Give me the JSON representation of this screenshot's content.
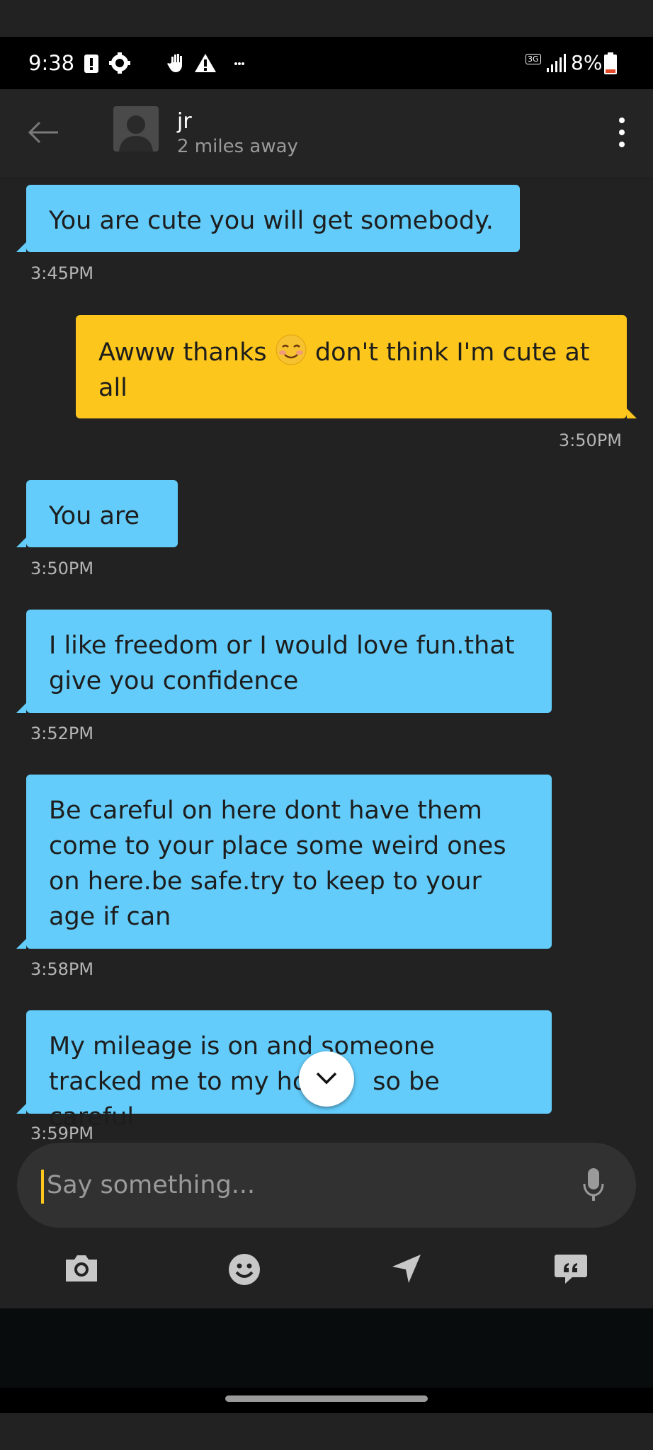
{
  "status_bar": {
    "time": "9:38",
    "network": "3G",
    "battery": "8%"
  },
  "header": {
    "name": "jr",
    "distance": "2 miles away"
  },
  "messages": [
    {
      "direction": "in",
      "text": "You are cute you will get somebody.",
      "time": "3:45PM"
    },
    {
      "direction": "out",
      "text_before_emoji": "Awww thanks",
      "emoji": "smiling-face-icon",
      "text_after_emoji": "don't think I'm cute at all",
      "time": "3:50PM"
    },
    {
      "direction": "in",
      "text": "You are",
      "time": "3:50PM"
    },
    {
      "direction": "in",
      "text": "I like freedom or I would love fun.that give you confidence",
      "time": "3:52PM"
    },
    {
      "direction": "in",
      "text": "Be careful on here dont have them come to your place some weird ones on here.be safe.try to keep to your age if can",
      "time": "3:58PM"
    },
    {
      "direction": "in",
      "text_part1": "My mileage is on and someone",
      "text_part2": "tracked me to my ho",
      "text_part3": "so be careful",
      "time": "3:59PM"
    }
  ],
  "composer": {
    "placeholder": "Say something..."
  },
  "toolbar": {
    "icons": [
      "camera-icon",
      "emoji-icon",
      "location-icon",
      "saved-phrases-icon"
    ]
  },
  "colors": {
    "incoming_bubble": "#63ccfa",
    "outgoing_bubble": "#fcc61c",
    "background": "#222222"
  }
}
